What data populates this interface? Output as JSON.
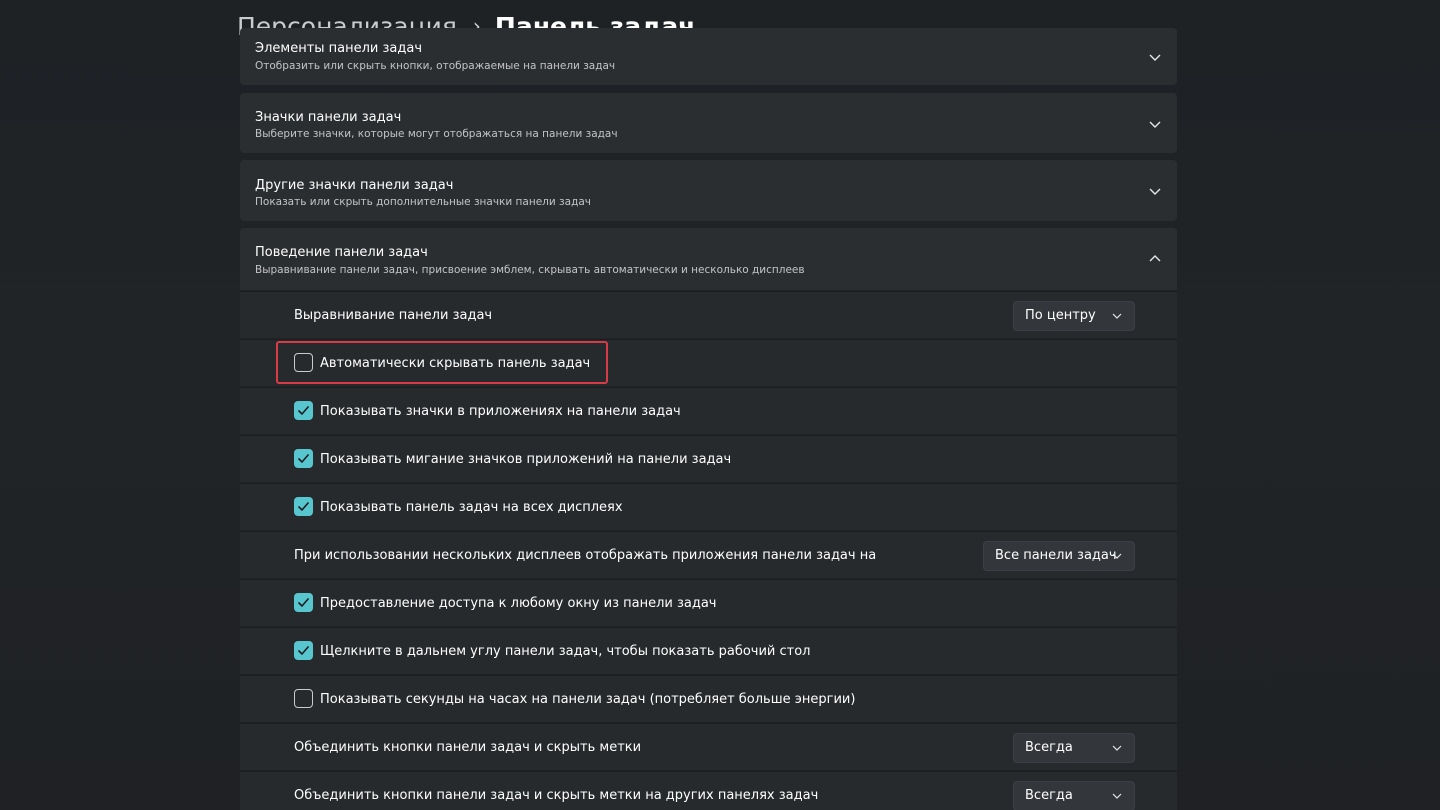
{
  "breadcrumb": {
    "parent": "Персонализация",
    "separator": "›",
    "current": "Панель задач"
  },
  "sections": [
    {
      "title": "Элементы панели задач",
      "description": "Отобразить или скрыть кнопки, отображаемые на панели задач",
      "expanded": false
    },
    {
      "title": "Значки панели задач",
      "description": "Выберите значки, которые могут отображаться на панели задач",
      "expanded": false
    },
    {
      "title": "Другие значки панели задач",
      "description": "Показать или скрыть дополнительные значки панели задач",
      "expanded": false
    },
    {
      "title": "Поведение панели задач",
      "description": "Выравнивание панели задач, присвоение эмблем, скрывать автоматически и несколько дисплеев",
      "expanded": true
    }
  ],
  "behavior": {
    "alignment": {
      "label": "Выравнивание панели задач",
      "value": "По центру"
    },
    "auto_hide": {
      "label": "Автоматически скрывать панель задач",
      "checked": false
    },
    "show_badges": {
      "label": "Показывать значки в приложениях на панели задач",
      "checked": true
    },
    "show_flashing": {
      "label": "Показывать мигание значков приложений на панели задач",
      "checked": true
    },
    "all_displays": {
      "label": "Показывать панель задач на всех дисплеях",
      "checked": true
    },
    "multi_display": {
      "label": "При использовании нескольких дисплеев отображать приложения панели задач на",
      "value": "Все панели задач"
    },
    "share_window": {
      "label": "Предоставление доступа к любому окну из панели задач",
      "checked": true
    },
    "far_corner": {
      "label": "Щелкните в дальнем углу панели задач, чтобы показать рабочий стол",
      "checked": true
    },
    "show_seconds": {
      "label": "Показывать секунды на часах на панели задач (потребляет больше энергии)",
      "checked": false
    },
    "combine_buttons": {
      "label": "Объединить кнопки панели задач и скрыть метки",
      "value": "Всегда"
    },
    "combine_other": {
      "label": "Объединить кнопки панели задач и скрыть метки на других панелях задач",
      "value": "Всегда"
    }
  },
  "colors": {
    "accent": "#58c6cf",
    "highlight": "#d93b46"
  }
}
